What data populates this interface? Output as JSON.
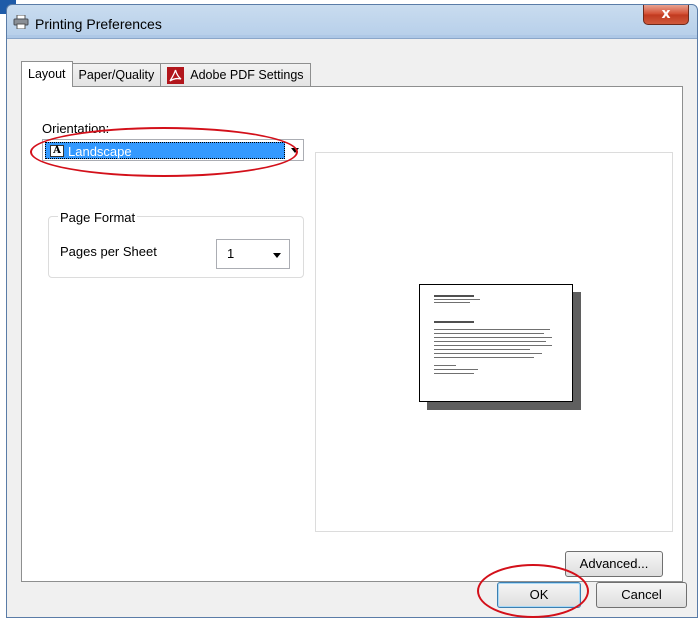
{
  "window": {
    "title": "Printing Preferences",
    "close_label": "x"
  },
  "tabs": [
    {
      "label": "Layout",
      "active": true
    },
    {
      "label": "Paper/Quality",
      "active": false
    },
    {
      "label": "Adobe PDF Settings",
      "active": false,
      "icon": "adobe-pdf-icon"
    }
  ],
  "layout": {
    "orientation_label": "Orientation:",
    "orientation_value": "Landscape",
    "orientation_icon_letter": "A",
    "page_format_title": "Page Format",
    "pages_per_sheet_label": "Pages per Sheet",
    "pages_per_sheet_value": "1",
    "advanced_label": "Advanced..."
  },
  "buttons": {
    "ok_label": "OK",
    "cancel_label": "Cancel"
  },
  "colors": {
    "highlight_ellipse": "#d3101a",
    "selection": "#3399ff",
    "close_button": "#c0391f",
    "pdf_icon": "#b2161c"
  }
}
